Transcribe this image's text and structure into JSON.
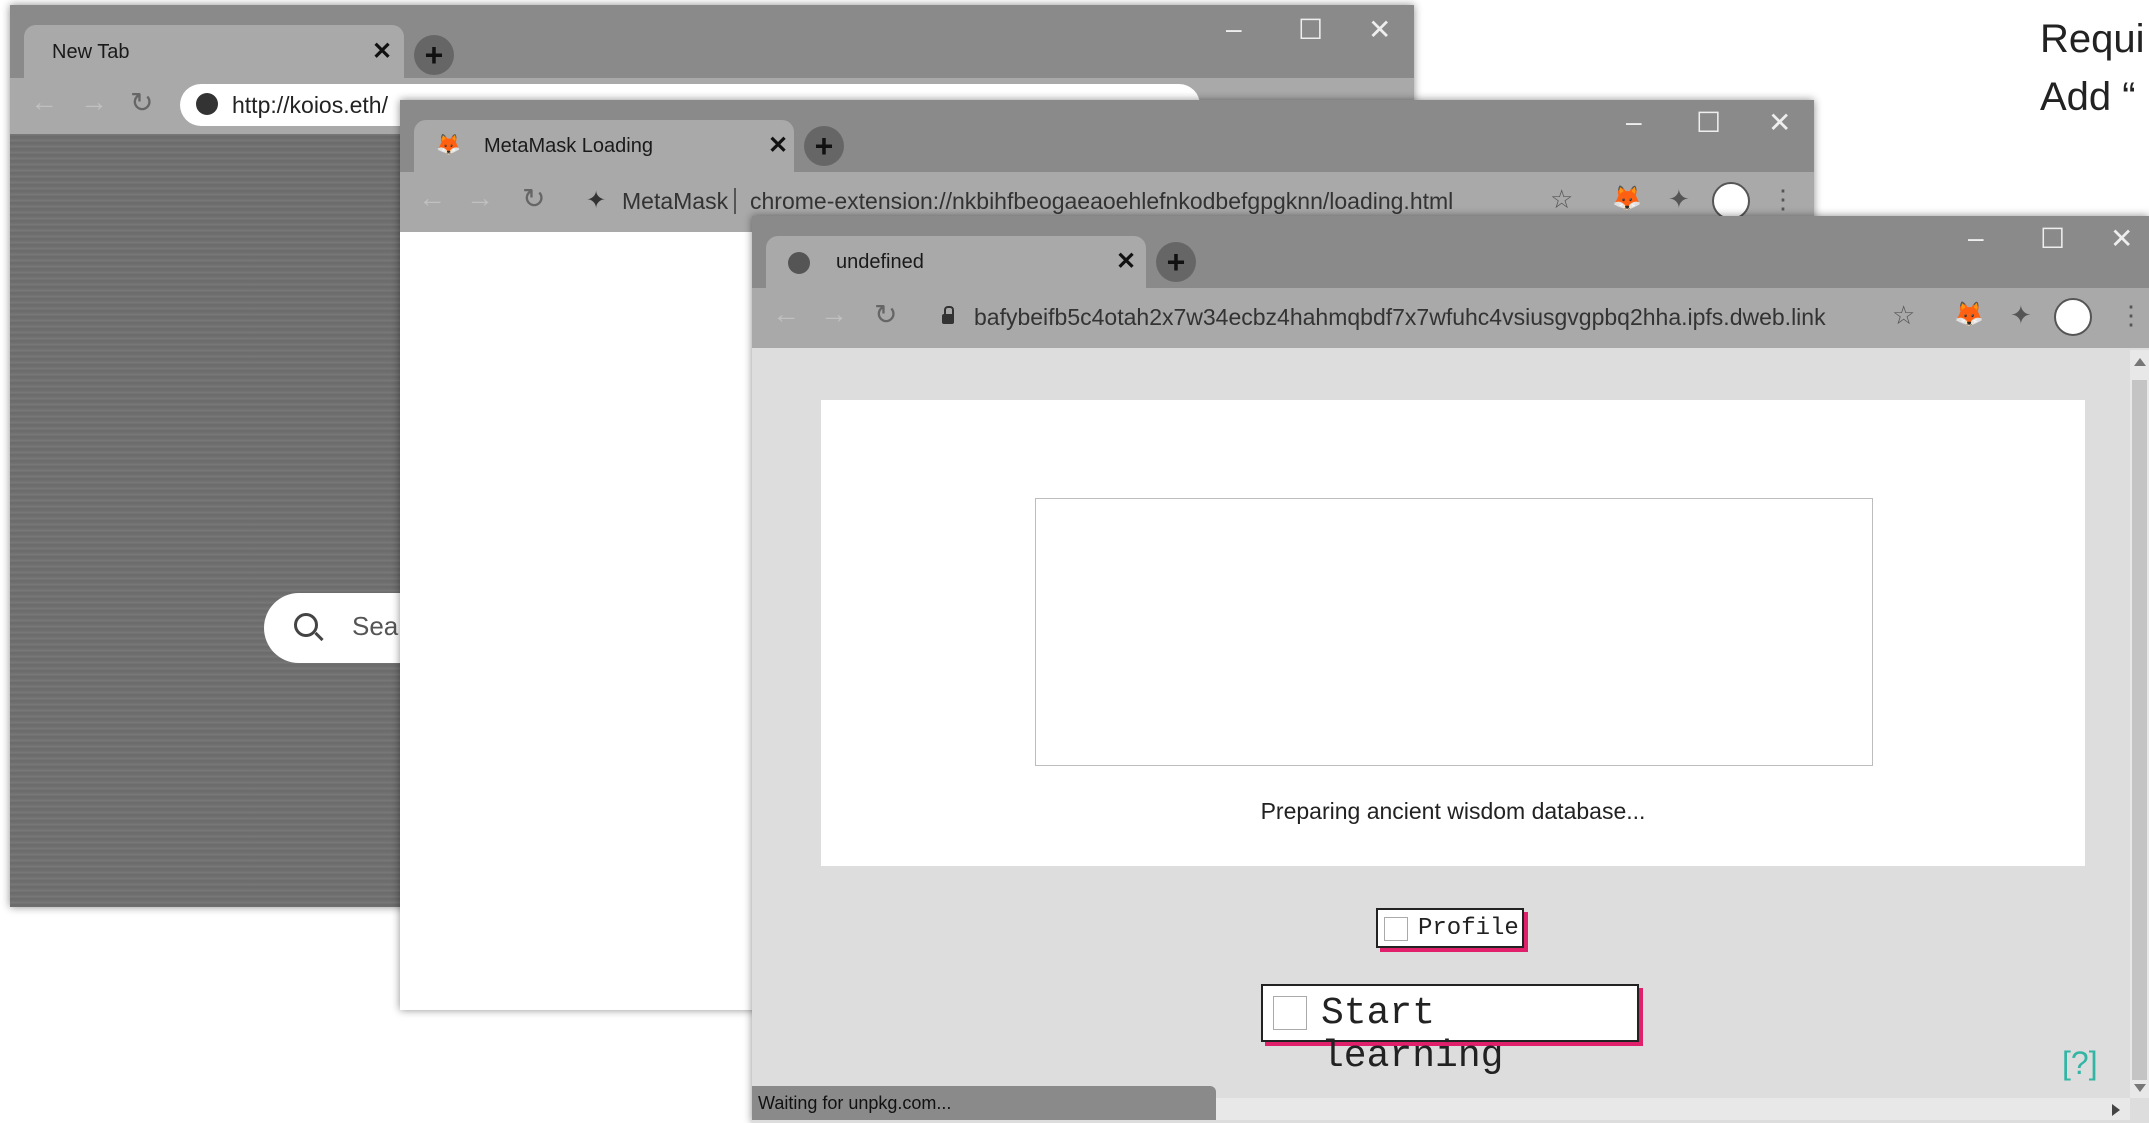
{
  "windows": {
    "back": {
      "tab_title": "New Tab",
      "url": "http://koios.eth/",
      "search_placeholder": "Sear"
    },
    "middle": {
      "tab_title": "MetaMask Loading",
      "ext_name": "MetaMask",
      "url": "chrome-extension://nkbihfbeogaeaoehlefnkodbefgpgknn/loading.html"
    },
    "front": {
      "tab_title": "undefined",
      "url": "bafybeifb5c4otah2x7w34ecbz4hahmqbdf7x7wfuhc4vsiusgvgpbq2hha.ipfs.dweb.link",
      "page": {
        "loading_text": "Preparing ancient wisdom database...",
        "profile_label": "Profile",
        "start_label": "Start learning",
        "help_link": "[?]"
      },
      "status_bar": "Waiting for unpkg.com..."
    }
  },
  "side_text": {
    "line1": "Requi",
    "line2": "Add “"
  },
  "icons": {
    "close": "✕",
    "plus": "+",
    "minimize": "–",
    "maximize": "☐",
    "back": "←",
    "forward": "→",
    "reload": "↻",
    "star": "☆",
    "menu": "⋮",
    "puzzle": "✦",
    "lock": "🔒",
    "search": "⌕",
    "fox": "🦊"
  },
  "colors": {
    "accent_pink": "#e0206a",
    "help_teal": "#33b5a5"
  }
}
